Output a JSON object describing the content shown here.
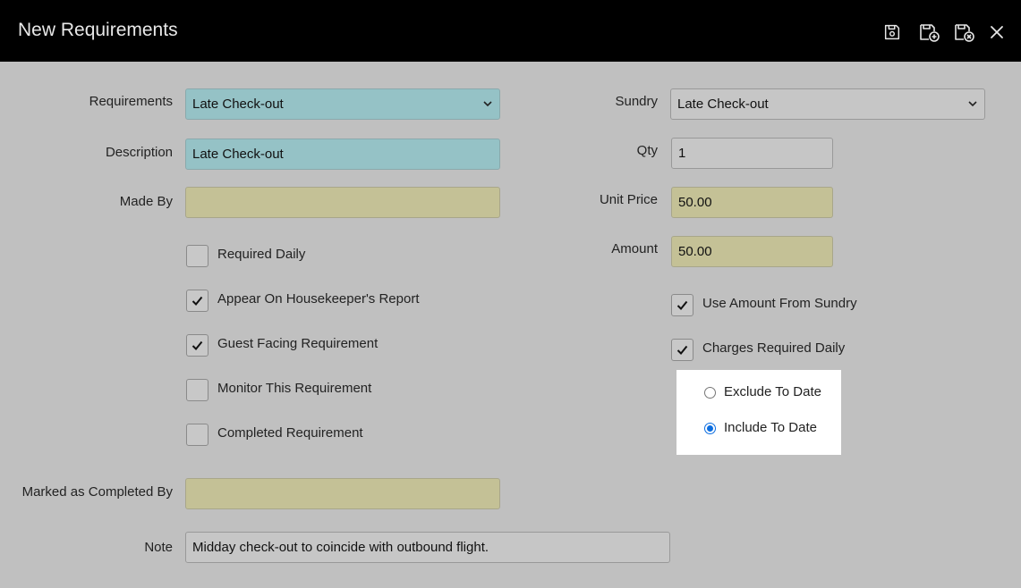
{
  "header": {
    "title": "New Requirements",
    "icons": [
      "save-icon",
      "save-and-new-icon",
      "save-and-close-icon",
      "close-icon"
    ]
  },
  "left": {
    "requirements": {
      "label": "Requirements",
      "value": "Late Check-out"
    },
    "description": {
      "label": "Description",
      "value": "Late Check-out"
    },
    "made_by": {
      "label": "Made By",
      "value": ""
    },
    "checkboxes": [
      {
        "label": "Required Daily",
        "checked": false
      },
      {
        "label": "Appear On Housekeeper's Report",
        "checked": true
      },
      {
        "label": "Guest Facing Requirement",
        "checked": true
      },
      {
        "label": "Monitor This Requirement",
        "checked": false
      },
      {
        "label": "Completed Requirement",
        "checked": false
      }
    ],
    "marked_completed_by": {
      "label": "Marked as Completed By",
      "value": ""
    },
    "note": {
      "label": "Note",
      "value": "Midday check-out to coincide with outbound flight."
    }
  },
  "right": {
    "sundry": {
      "label": "Sundry",
      "value": "Late Check-out"
    },
    "qty": {
      "label": "Qty",
      "value": "1"
    },
    "unit_price": {
      "label": "Unit Price",
      "value": "50.00"
    },
    "amount": {
      "label": "Amount",
      "value": "50.00"
    },
    "checkboxes": [
      {
        "label": "Use Amount From Sundry",
        "checked": true
      },
      {
        "label": "Charges Required Daily",
        "checked": true
      }
    ],
    "radios": [
      {
        "label": "Exclude To Date",
        "selected": false
      },
      {
        "label": "Include To Date",
        "selected": true
      }
    ]
  },
  "colors": {
    "header_bg": "#000000",
    "body_bg": "#c0c0c0",
    "teal_field": "#95c2c6",
    "khaki_field": "#c4c196",
    "radio_accent": "#0b6de0"
  }
}
